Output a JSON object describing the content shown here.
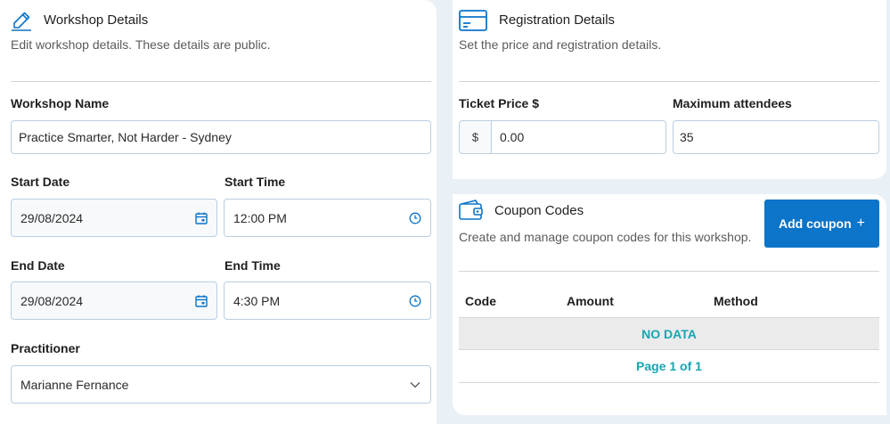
{
  "workshop": {
    "title": "Workshop Details",
    "subtitle": "Edit workshop details. These details are public.",
    "name_label": "Workshop Name",
    "name_value": "Practice Smarter, Not Harder - Sydney",
    "start_date_label": "Start Date",
    "start_date_value": "29/08/2024",
    "start_time_label": "Start Time",
    "start_time_value": "12:00 PM",
    "end_date_label": "End Date",
    "end_date_value": "29/08/2024",
    "end_time_label": "End Time",
    "end_time_value": "4:30 PM",
    "practitioner_label": "Practitioner",
    "practitioner_value": "Marianne Fernance"
  },
  "registration": {
    "title": "Registration Details",
    "subtitle": "Set the price and registration details.",
    "ticket_price_label": "Ticket Price $",
    "currency_prefix": "$",
    "ticket_price_value": "0.00",
    "max_attendees_label": "Maximum attendees",
    "max_attendees_value": "35"
  },
  "coupons": {
    "title": "Coupon Codes",
    "subtitle": "Create and manage coupon codes for this workshop.",
    "add_button_label": "Add coupon",
    "add_button_icon": "+",
    "columns": [
      "Code",
      "Amount",
      "Method"
    ],
    "empty_text": "NO DATA",
    "pagination": "Page 1 of 1"
  },
  "colors": {
    "accent": "#0c74c9",
    "teal": "#18a5b0",
    "background": "#e9f0f6"
  },
  "icons": {
    "workshop": "pencil-icon",
    "registration": "credit-card-icon",
    "coupons": "wallet-icon",
    "date": "calendar-icon",
    "time": "clock-icon",
    "select": "chevron-down-icon"
  }
}
